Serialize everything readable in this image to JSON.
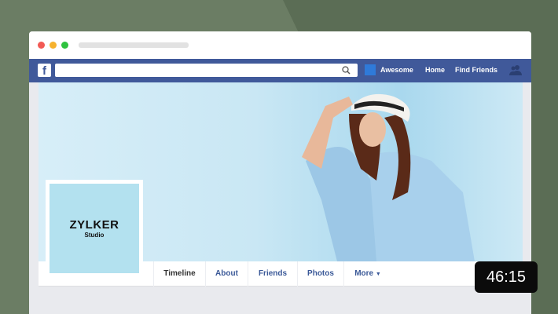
{
  "navbar": {
    "page_name": "Awesome",
    "home": "Home",
    "find_friends": "Find Friends",
    "search_placeholder": ""
  },
  "profile": {
    "name": "ZYLKER",
    "subtitle": "Studio"
  },
  "tabs": [
    "Timeline",
    "About",
    "Friends",
    "Photos",
    "More"
  ],
  "video": {
    "duration": "46:15"
  },
  "colors": {
    "fb_blue": "#40599a",
    "background": "#6b7d64"
  }
}
